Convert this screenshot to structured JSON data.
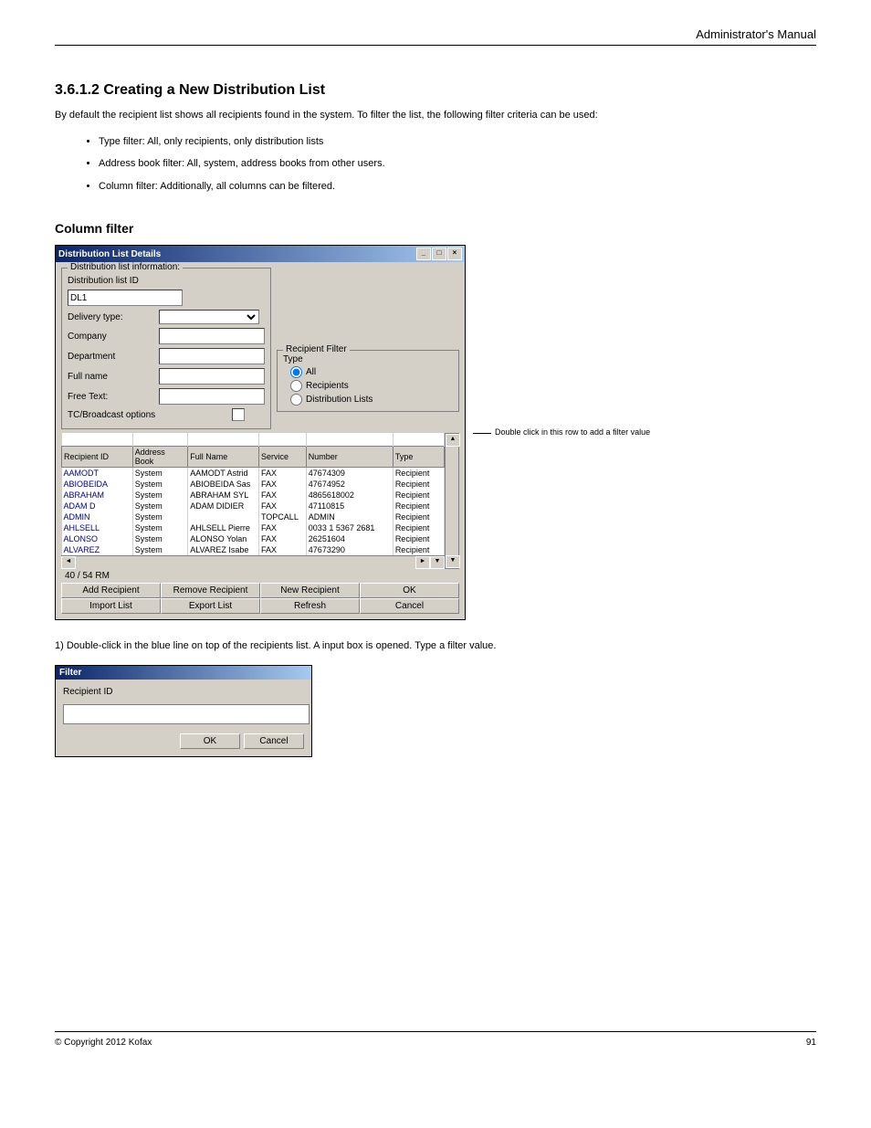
{
  "header": {
    "manual_title": "Administrator's Manual"
  },
  "section": {
    "numbered_title": "3.6.1.2 Creating a New Distribution List",
    "intro": "By default the recipient list shows all recipients found in the system. To filter the list, the following filter criteria can be used:",
    "bullets": [
      "Type filter: All, only recipients, only distribution lists",
      "Address book filter: All, system, address books from other users.",
      "Column filter: Additionally, all columns can be filtered."
    ],
    "step_text": "1) Double-click in the blue line on top of the recipients list. A input box is opened. Type a filter value."
  },
  "window1": {
    "title": "Distribution List Details",
    "group_label": "Distribution list information:",
    "labels": {
      "dist_id": "Distribution list ID",
      "delivery_type": "Delivery type:",
      "company": "Company",
      "department": "Department",
      "full_name": "Full name",
      "free_text": "Free Text:",
      "tc_broadcast": "TC/Broadcast options"
    },
    "values": {
      "dist_id": "DL1"
    },
    "recipient_filter": {
      "label": "Recipient Filter",
      "type_label": "Type",
      "opt_all": "All",
      "opt_recipients": "Recipients",
      "opt_dist": "Distribution Lists"
    },
    "columns": [
      "Recipient ID",
      "Address Book",
      "Full Name",
      "Service",
      "Number",
      "Type"
    ],
    "rows": [
      {
        "id": "AAMODT",
        "book": "System",
        "name": "AAMODT Astrid",
        "service": "FAX",
        "number": "47674309",
        "type": "Recipient"
      },
      {
        "id": "ABIOBEIDA",
        "book": "System",
        "name": "ABIOBEIDA Sas",
        "service": "FAX",
        "number": "47674952",
        "type": "Recipient"
      },
      {
        "id": "ABRAHAM",
        "book": "System",
        "name": "ABRAHAM SYL",
        "service": "FAX",
        "number": "4865618002",
        "type": "Recipient"
      },
      {
        "id": "ADAM D",
        "book": "System",
        "name": "ADAM DIDIER",
        "service": "FAX",
        "number": "47110815",
        "type": "Recipient"
      },
      {
        "id": "ADMIN",
        "book": "System",
        "name": "",
        "service": "TOPCALL",
        "number": "ADMIN",
        "type": "Recipient"
      },
      {
        "id": "AHLSELL",
        "book": "System",
        "name": "AHLSELL Pierre",
        "service": "FAX",
        "number": "0033 1 5367 2681",
        "type": "Recipient"
      },
      {
        "id": "ALONSO",
        "book": "System",
        "name": "ALONSO Yolan",
        "service": "FAX",
        "number": "26251604",
        "type": "Recipient"
      },
      {
        "id": "ALVAREZ",
        "book": "System",
        "name": "ALVAREZ Isabe",
        "service": "FAX",
        "number": "47673290",
        "type": "Recipient"
      }
    ],
    "status": "40 / 54        RM",
    "buttons": {
      "add": "Add Recipient",
      "remove": "Remove Recipient",
      "new": "New Recipient",
      "ok": "OK",
      "import": "Import List",
      "export": "Export List",
      "refresh": "Refresh",
      "cancel": "Cancel"
    }
  },
  "annotation_text": "Double click in this row to add a filter value",
  "window2": {
    "title": "Filter",
    "label": "Recipient ID",
    "ok": "OK",
    "cancel": "Cancel"
  },
  "footer": {
    "copyright": "© Copyright 2012 Kofax",
    "page": "91"
  },
  "icons": {
    "minimize": "_",
    "maximize": "□",
    "close": "×",
    "left": "◄",
    "right": "►",
    "up": "▲",
    "down": "▼"
  }
}
